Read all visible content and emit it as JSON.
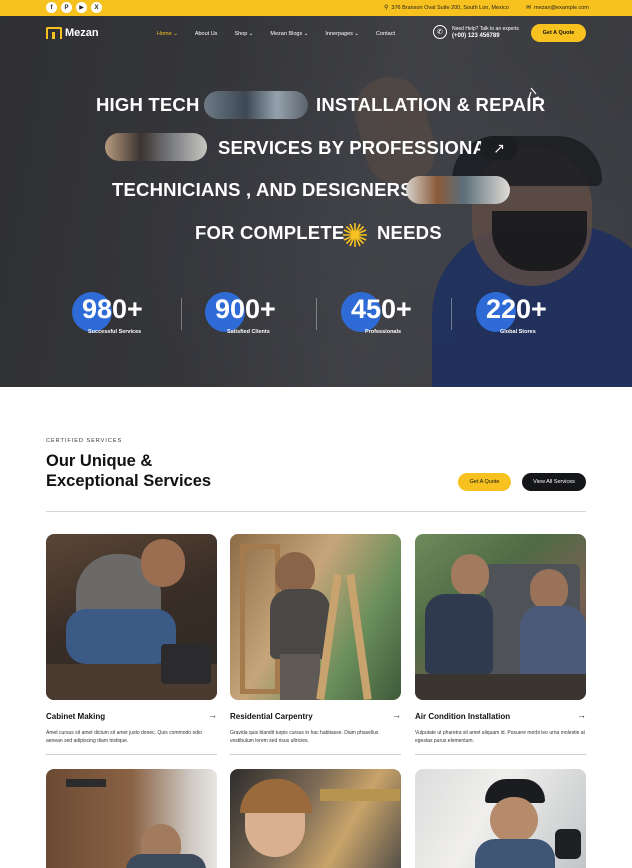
{
  "topbar": {
    "socials": [
      {
        "icon": "facebook-icon",
        "glyph": "f"
      },
      {
        "icon": "pinterest-icon",
        "glyph": "P"
      },
      {
        "icon": "youtube-icon",
        "glyph": "▶"
      },
      {
        "icon": "x-icon",
        "glyph": "X"
      }
    ],
    "address": "376 Branson Oval Suite 200, South Lon, Mexico",
    "email": "mezan@example.com"
  },
  "header": {
    "logo": "Mezan",
    "nav": [
      {
        "label": "Home ⌄",
        "active": true
      },
      {
        "label": "About Us",
        "active": false
      },
      {
        "label": "Shop ⌄",
        "active": false
      },
      {
        "label": "Mezan Blogs ⌄",
        "active": false
      },
      {
        "label": "Innerpages ⌄",
        "active": false
      },
      {
        "label": "Contact",
        "active": false
      }
    ],
    "help_label": "Need Help? Talk to an experts",
    "help_phone": "(+00) 123 456789",
    "cta": "Get A Quote"
  },
  "hero": {
    "line1a": "HIGH TECH",
    "line1b": "INSTALLATION & REPAIR",
    "line2": "SERVICES BY PROFESSIONAL",
    "line3": "TECHNICIANS ,  AND DESIGNERS",
    "line4a": "FOR COMPLETE",
    "line4b": "NEEDS",
    "stats": [
      {
        "value": "980+",
        "label": "Successful Services"
      },
      {
        "value": "900+",
        "label": "Satisfied Clients"
      },
      {
        "value": "450+",
        "label": "Professionals"
      },
      {
        "value": "220+",
        "label": "Global Stores"
      }
    ]
  },
  "services": {
    "eyebrow": "CERTIFIED SERVICES",
    "title_line1": "Our Unique &",
    "title_line2": "Exceptional Services",
    "quote_button": "Get A Quote",
    "all_button": "View All Services",
    "cards": [
      {
        "title": "Cabinet Making",
        "desc": "Amet cursus sit amet dictum sit amet justo donec. Quis commodo odio aenean sed adipiscing diam tristique."
      },
      {
        "title": "Residential Carpentry",
        "desc": "Gravida quis blandit turpis cursus in hac habitasse. Diam phasellus vestibulum lorem sed risus ultricies."
      },
      {
        "title": "Air Condition Installation",
        "desc": "Vulputate ut pharetra sit amet aliquam id. Posuere morbi leo urna molestie at egestas purus elementum."
      }
    ]
  },
  "colors": {
    "accent": "#f7c21f",
    "blue": "#2f6bd6",
    "dark": "#15161a"
  }
}
